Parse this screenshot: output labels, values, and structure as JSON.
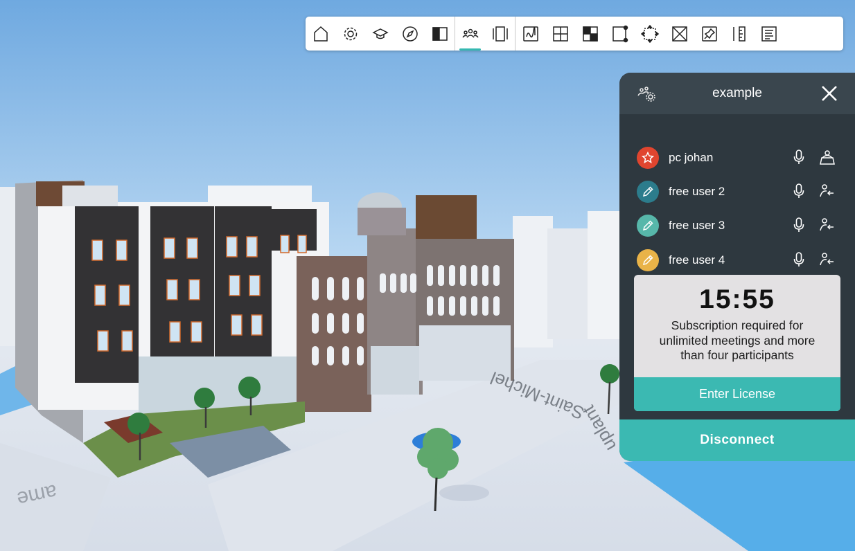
{
  "toolbar": {
    "groups": [
      [
        {
          "name": "home-icon",
          "active": false
        },
        {
          "name": "settings-gear-icon",
          "active": false
        },
        {
          "name": "graduation-cap-icon",
          "active": false
        },
        {
          "name": "compass-icon",
          "active": false
        },
        {
          "name": "split-view-icon",
          "active": false
        }
      ],
      [
        {
          "name": "collaboration-people-icon",
          "active": true
        },
        {
          "name": "carousel-icon",
          "active": false
        }
      ],
      [
        {
          "name": "sketch-draw-icon",
          "active": false
        },
        {
          "name": "section-cross-icon",
          "active": false
        },
        {
          "name": "checker-pattern-icon",
          "active": false
        },
        {
          "name": "bounding-box-icon",
          "active": false
        },
        {
          "name": "move-arrows-icon",
          "active": false
        },
        {
          "name": "x-box-icon",
          "active": false
        },
        {
          "name": "pin-icon",
          "active": false
        },
        {
          "name": "ruler-icon",
          "active": false
        },
        {
          "name": "document-text-icon",
          "active": false
        }
      ]
    ],
    "active_accent": "#35b9b1"
  },
  "panel": {
    "title": "example",
    "header_icon": "group-settings-icon",
    "close_icon": "close-icon",
    "participants": [
      {
        "name": "pc johan",
        "role_icon": "star-icon",
        "color": "#e0452f",
        "mic": "microphone-icon",
        "action": "presenter-icon"
      },
      {
        "name": "free user 2",
        "role_icon": "pencil-icon",
        "color": "#2c7c8c",
        "mic": "microphone-icon",
        "action": "user-follow-icon"
      },
      {
        "name": "free user 3",
        "role_icon": "pencil-icon",
        "color": "#57b7aa",
        "mic": "microphone-icon",
        "action": "user-follow-icon"
      },
      {
        "name": "free user 4",
        "role_icon": "pencil-icon",
        "color": "#e9b348",
        "mic": "microphone-icon",
        "action": "user-follow-icon"
      }
    ],
    "license": {
      "timer": "15:55",
      "message": "Subscription required for unlimited meetings and more than four participants",
      "button": "Enter License"
    },
    "disconnect": "Disconnect",
    "accent": "#3bb9b2"
  },
  "scene": {
    "street_labels": [
      "Saint-Michel",
      "uplant",
      "ame"
    ]
  }
}
